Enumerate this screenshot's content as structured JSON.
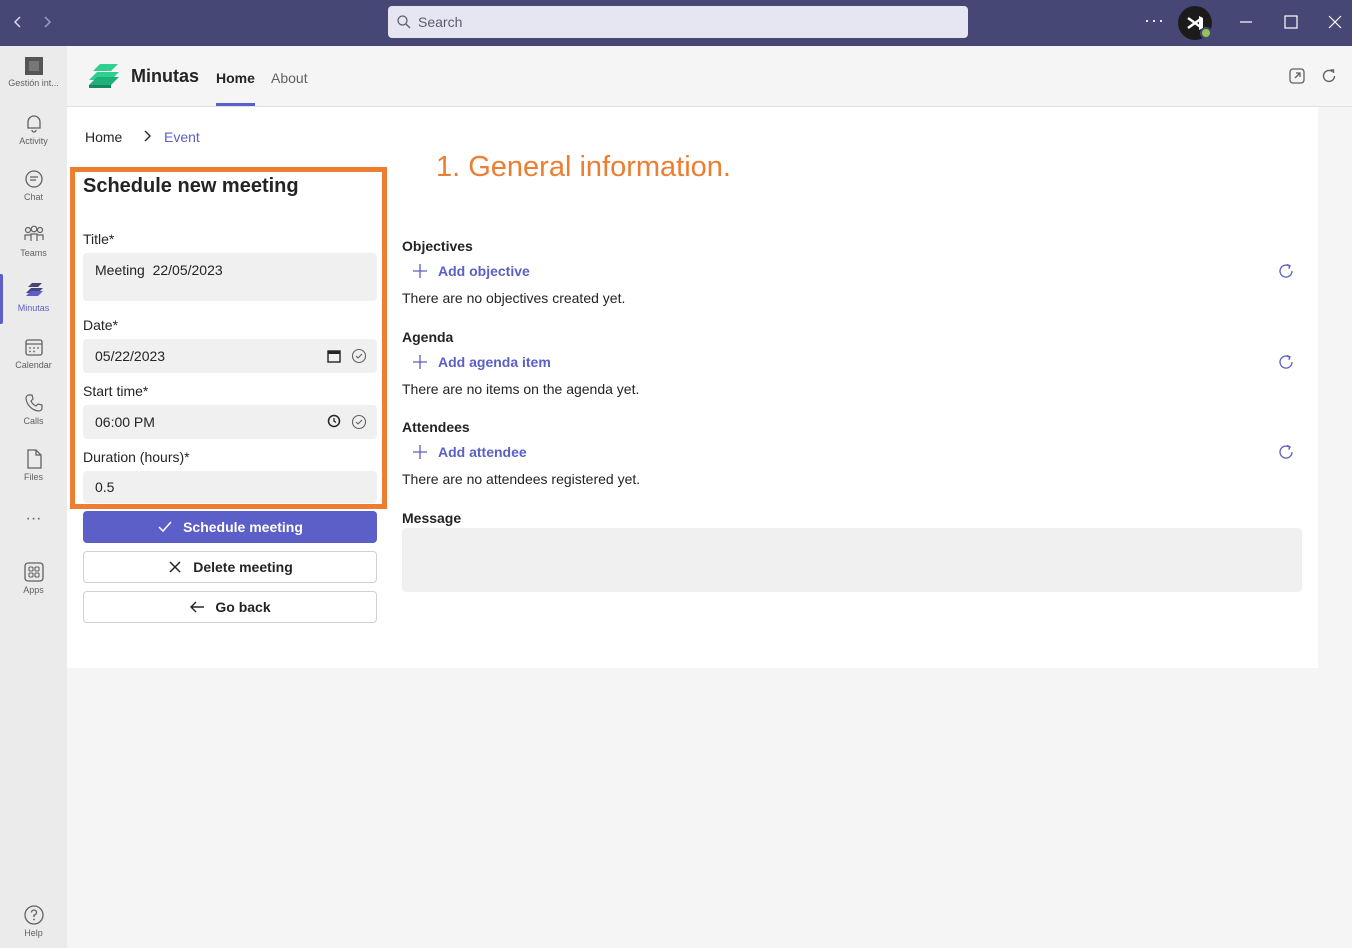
{
  "titlebar": {
    "back_icon": "chevron-left-icon",
    "forward_icon": "chevron-right-icon",
    "search_placeholder": "Search",
    "more_label": "···"
  },
  "rail": {
    "items": [
      {
        "label": "Gestión int...",
        "icon": "org-icon"
      },
      {
        "label": "Activity",
        "icon": "bell-icon"
      },
      {
        "label": "Chat",
        "icon": "chat-icon"
      },
      {
        "label": "Teams",
        "icon": "teams-icon"
      },
      {
        "label": "Minutas",
        "icon": "minutas-icon",
        "active": true
      },
      {
        "label": "Calendar",
        "icon": "calendar-icon"
      },
      {
        "label": "Calls",
        "icon": "phone-icon"
      },
      {
        "label": "Files",
        "icon": "file-icon"
      },
      {
        "label": "Apps",
        "icon": "apps-icon"
      },
      {
        "label": "Help",
        "icon": "help-icon"
      }
    ],
    "more_label": "···"
  },
  "app": {
    "name": "Minutas",
    "tabs": [
      {
        "label": "Home",
        "active": true
      },
      {
        "label": "About",
        "active": false
      }
    ]
  },
  "breadcrumb": {
    "home": "Home",
    "current": "Event"
  },
  "annotation": "1. General information.",
  "form": {
    "title": "Schedule new meeting",
    "title_label": "Title*",
    "title_value": "Meeting  22/05/2023",
    "date_label": "Date*",
    "date_value": "05/22/2023",
    "start_label": "Start time*",
    "start_value": "06:00 PM",
    "duration_label": "Duration (hours)*",
    "duration_value": "0.5"
  },
  "buttons": {
    "schedule": "Schedule meeting",
    "delete": "Delete meeting",
    "back": "Go back"
  },
  "sections": {
    "objectives": {
      "title": "Objectives",
      "add": "Add objective",
      "empty": "There are no objectives created yet."
    },
    "agenda": {
      "title": "Agenda",
      "add": "Add agenda item",
      "empty": "There are no items on the agenda yet."
    },
    "attendees": {
      "title": "Attendees",
      "add": "Add attendee",
      "empty": "There are no attendees registered yet."
    },
    "message": {
      "title": "Message"
    }
  },
  "colors": {
    "titlebar": "#464775",
    "accent": "#5b5fc7",
    "annotation": "#ed7d31",
    "logo": "#2fd08f"
  }
}
